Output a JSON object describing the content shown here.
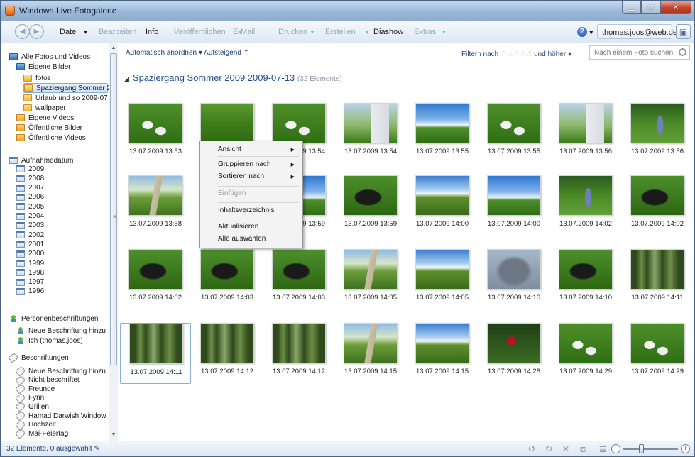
{
  "window": {
    "title": "Windows Live Fotogalerie"
  },
  "menu": {
    "items": [
      {
        "label": "Datei",
        "dropdown": true,
        "disabled": false
      },
      {
        "label": "Bearbeiten",
        "dropdown": false,
        "disabled": true
      },
      {
        "label": "Info",
        "dropdown": false,
        "disabled": false
      },
      {
        "label": "Veröffentlichen",
        "dropdown": true,
        "disabled": true
      },
      {
        "label": "E-Mail",
        "dropdown": false,
        "disabled": true
      },
      {
        "label": "Drucken",
        "dropdown": true,
        "disabled": true
      },
      {
        "label": "Erstellen",
        "dropdown": true,
        "disabled": true
      },
      {
        "label": "Diashow",
        "dropdown": false,
        "disabled": false
      },
      {
        "label": "Extras",
        "dropdown": true,
        "disabled": true
      }
    ],
    "user": "thomas.joos@web.de ▾",
    "help_caret": "▾"
  },
  "sidebar": {
    "library": "Alle Fotos und Videos",
    "eigene_bilder": "Eigene Bilder",
    "folders": [
      "fotos",
      "Spaziergang Sommer 2",
      "Urlaub und so 2009-07",
      "wallpaper"
    ],
    "selected_folder": 1,
    "eigene_videos": "Eigene Videos",
    "public_pictures": "Öffentliche Bilder",
    "public_videos": "Öffentliche Videos",
    "date_header": "Aufnahmedatum",
    "years": [
      "2009",
      "2008",
      "2007",
      "2006",
      "2005",
      "2004",
      "2003",
      "2002",
      "2001",
      "2000",
      "1999",
      "1998",
      "1997",
      "1996"
    ],
    "people_header": "Personenbeschriftungen",
    "people_new": "Neue Beschriftung hinzu",
    "people_me": "Ich (thomas.joos)",
    "tags_header": "Beschriftungen",
    "tags": [
      "Neue Beschriftung hinzu",
      "Nicht beschriftet",
      "Freunde",
      "Fynn",
      "Grillen",
      "Hamad Darwish Window",
      "Hochzeit",
      "Mai-Feiertag"
    ]
  },
  "content": {
    "sort": "Automatisch anordnen ▾ Aufsteigend ⇡",
    "filter_prefix": "Filtern nach",
    "filter_stars": "☆☆☆☆☆",
    "filter_suffix": "und höher ▾",
    "search_placeholder": "Nach einem Foto suchen",
    "group_title": "Spaziergang Sommer 2009 2009-07-13",
    "group_count": "(32 Elemente)",
    "selected_index": 24,
    "photos": [
      {
        "caption": "13.07.2009 13:53",
        "theme": "geese"
      },
      {
        "caption": "13.07.2009 13:53",
        "theme": "grass"
      },
      {
        "caption": "13.07.2009 13:54",
        "theme": "geese"
      },
      {
        "caption": "13.07.2009 13:54",
        "theme": "house"
      },
      {
        "caption": "13.07.2009 13:55",
        "theme": "sky"
      },
      {
        "caption": "13.07.2009 13:55",
        "theme": "geese"
      },
      {
        "caption": "13.07.2009 13:56",
        "theme": "house"
      },
      {
        "caption": "13.07.2009 13:56",
        "theme": "person"
      },
      {
        "caption": "13.07.2009 13:58",
        "theme": "path"
      },
      {
        "caption": "13.07.2009 13:58",
        "theme": "grass"
      },
      {
        "caption": "13.07.2009 13:59",
        "theme": "sky"
      },
      {
        "caption": "13.07.2009 13:59",
        "theme": "dog"
      },
      {
        "caption": "13.07.2009 14:00",
        "theme": "field"
      },
      {
        "caption": "13.07.2009 14:00",
        "theme": "sky"
      },
      {
        "caption": "13.07.2009 14:02",
        "theme": "person"
      },
      {
        "caption": "13.07.2009 14:02",
        "theme": "dog"
      },
      {
        "caption": "13.07.2009 14:02",
        "theme": "dog"
      },
      {
        "caption": "13.07.2009 14:03",
        "theme": "dog"
      },
      {
        "caption": "13.07.2009 14:03",
        "theme": "dog"
      },
      {
        "caption": "13.07.2009 14:05",
        "theme": "path"
      },
      {
        "caption": "13.07.2009 14:05",
        "theme": "field"
      },
      {
        "caption": "13.07.2009 14:10",
        "theme": "dogclose"
      },
      {
        "caption": "13.07.2009 14:10",
        "theme": "dog"
      },
      {
        "caption": "13.07.2009 14:11",
        "theme": "forest"
      },
      {
        "caption": "13.07.2009 14:11",
        "theme": "forest"
      },
      {
        "caption": "13.07.2009 14:12",
        "theme": "forest"
      },
      {
        "caption": "13.07.2009 14:12",
        "theme": "forest"
      },
      {
        "caption": "13.07.2009 14:15",
        "theme": "path"
      },
      {
        "caption": "13.07.2009 14:15",
        "theme": "field"
      },
      {
        "caption": "13.07.2009 14:28",
        "theme": "rose"
      },
      {
        "caption": "13.07.2009 14:29",
        "theme": "geese"
      },
      {
        "caption": "13.07.2009 14:29",
        "theme": "geese"
      }
    ]
  },
  "context_menu": {
    "items": [
      "Ansicht",
      "Gruppieren nach",
      "Sortieren nach",
      "Einfügen",
      "Inhaltsverzeichnis",
      "Aktualisieren",
      "Alle auswählen"
    ],
    "submenu": [
      true,
      true,
      true,
      false,
      false,
      false,
      false
    ],
    "disabled": [
      false,
      false,
      false,
      true,
      false,
      false,
      false
    ]
  },
  "status": {
    "text": "32 Elemente, 0 ausgewählt"
  },
  "colors": {
    "accent": "#1f4e8c",
    "selection": "#84acdd",
    "titlebar": "#9bb7d6"
  }
}
